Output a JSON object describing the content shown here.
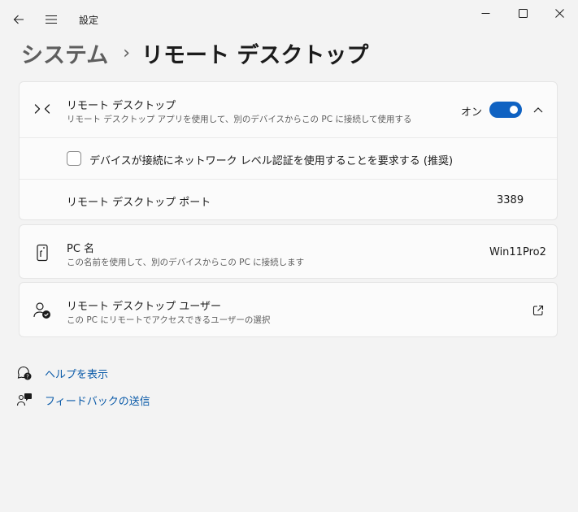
{
  "window": {
    "app_title": "設定",
    "icons": {
      "back": "back-arrow-icon",
      "menu": "hamburger-menu-icon",
      "minimize": "minimize-icon",
      "maximize": "maximize-icon",
      "close": "close-icon"
    }
  },
  "breadcrumb": {
    "parent": "システム",
    "separator": "›",
    "current": "リモート デスクトップ"
  },
  "remote_desktop": {
    "title": "リモート デスクトップ",
    "description": "リモート デスクトップ アプリを使用して、別のデバイスからこの PC に接続して使用する",
    "toggle_label": "オン",
    "toggle_on": true,
    "icon": "remote-desktop-icon",
    "accent_color": "#0f62c2"
  },
  "nla_option": {
    "label": "デバイスが接続にネットワーク レベル認証を使用することを要求する (推奨)",
    "checked": false
  },
  "port": {
    "label": "リモート デスクトップ ポート",
    "value": "3389"
  },
  "pc_name": {
    "title": "PC 名",
    "description": "この名前を使用して、別のデバイスからこの PC に接続します",
    "value": "Win11Pro2",
    "icon": "pc-name-icon"
  },
  "users": {
    "title": "リモート デスクトップ ユーザー",
    "description": "この PC にリモートでアクセスできるユーザーの選択",
    "icon": "user-check-icon"
  },
  "links": {
    "help": "ヘルプを表示",
    "feedback": "フィードバックの送信"
  }
}
